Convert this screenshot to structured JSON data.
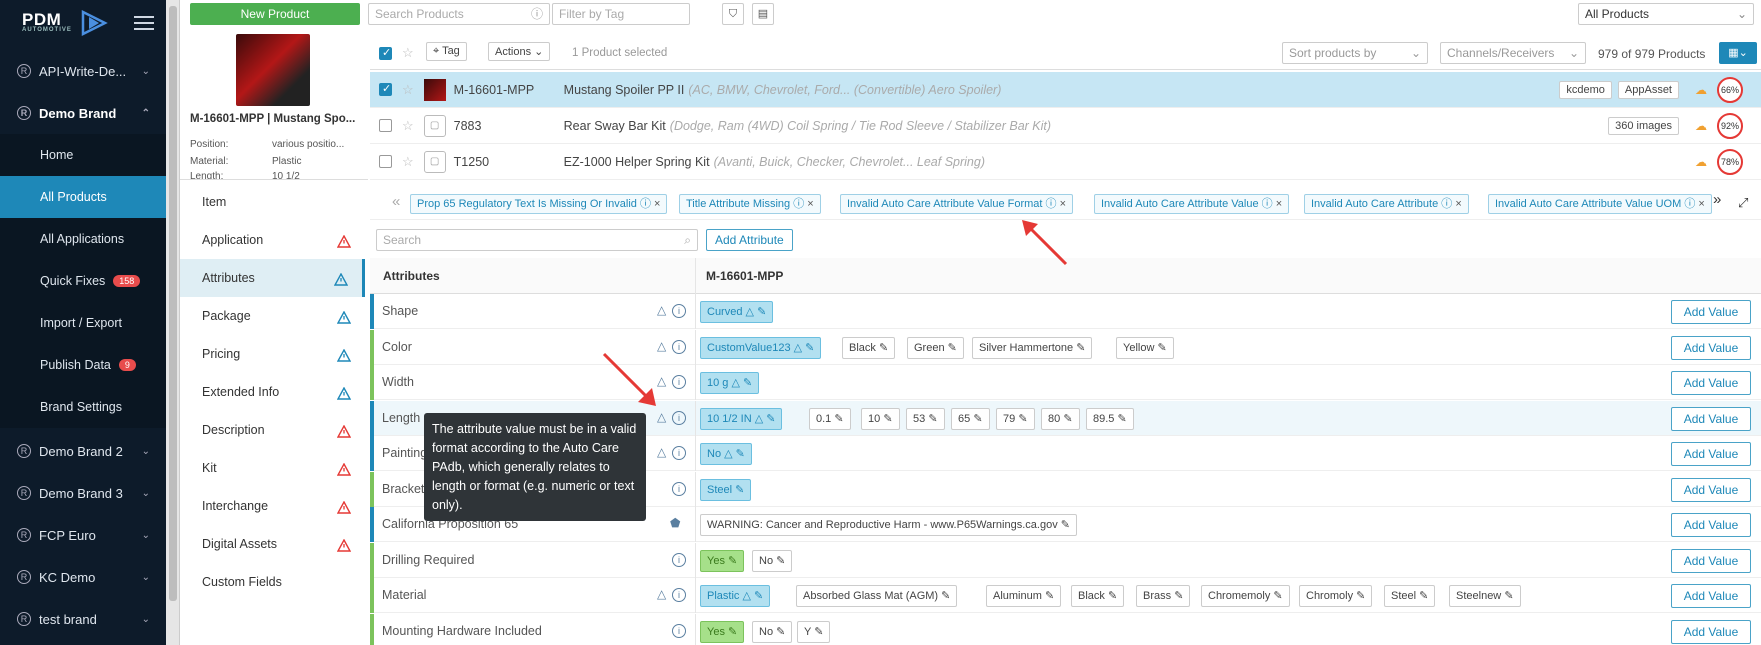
{
  "app": {
    "logo_text": "PDM",
    "logo_sub": "AUTOMOTIVE"
  },
  "sidebar": {
    "brands": [
      {
        "label": "API-Write-De...",
        "expanded": false
      },
      {
        "label": "Demo Brand",
        "expanded": true
      },
      {
        "label": "Demo Brand 2",
        "expanded": false
      },
      {
        "label": "Demo Brand 3",
        "expanded": false
      },
      {
        "label": "FCP Euro",
        "expanded": false
      },
      {
        "label": "KC Demo",
        "expanded": false
      },
      {
        "label": "test brand",
        "expanded": false
      }
    ],
    "sub_items": [
      {
        "label": "Home"
      },
      {
        "label": "All Products",
        "active": true
      },
      {
        "label": "All Applications"
      },
      {
        "label": "Quick Fixes",
        "badge": "158"
      },
      {
        "label": "Import / Export"
      },
      {
        "label": "Publish Data",
        "badge": "9"
      },
      {
        "label": "Brand Settings"
      }
    ]
  },
  "toolbar": {
    "new_product": "New Product",
    "search_placeholder": "Search Products",
    "filter_placeholder": "Filter by Tag",
    "scope_select": "All Products"
  },
  "list_header": {
    "tag": "Tag",
    "actions": "Actions",
    "selected": "1 Product selected",
    "sort": "Sort products by",
    "channels": "Channels/Receivers",
    "count": "979 of 979 Products"
  },
  "products": [
    {
      "part": "M-16601-MPP",
      "name": "Mustang Spoiler PP II",
      "detail": "(AC, BMW, Chevrolet, Ford... (Convertible) Aero Spoiler)",
      "tags": [
        "kcdemo",
        "AppAsset"
      ],
      "score": "66%",
      "selected": true
    },
    {
      "part": "7883",
      "name": "Rear Sway Bar Kit",
      "detail": "(Dodge, Ram (4WD) Coil Spring / Tie Rod Sleeve / Stabilizer Bar Kit)",
      "tags": [
        "360 images"
      ],
      "score": "92%",
      "selected": false
    },
    {
      "part": "T1250",
      "name": "EZ-1000 Helper Spring Kit",
      "detail": "(Avanti, Buick, Checker, Chevrolet... Leaf Spring)",
      "tags": [],
      "score": "78%",
      "selected": false
    }
  ],
  "product_card": {
    "title": "M-16601-MPP | Mustang Spo...",
    "position_label": "Position:",
    "position_value": "various positio...",
    "material_label": "Material:",
    "material_value": "Plastic",
    "length_label": "Length:",
    "length_value": "10 1/2"
  },
  "left_nav": [
    {
      "label": "Item",
      "warn": null
    },
    {
      "label": "Application",
      "warn": "red"
    },
    {
      "label": "Attributes",
      "warn": "blue",
      "active": true
    },
    {
      "label": "Package",
      "warn": "blue"
    },
    {
      "label": "Pricing",
      "warn": "blue"
    },
    {
      "label": "Extended Info",
      "warn": "blue"
    },
    {
      "label": "Description",
      "warn": "red"
    },
    {
      "label": "Kit",
      "warn": "red"
    },
    {
      "label": "Interchange",
      "warn": "red"
    },
    {
      "label": "Digital Assets",
      "warn": "red"
    },
    {
      "label": "Custom Fields",
      "warn": null
    }
  ],
  "filter_chips": [
    "Prop 65 Regulatory Text Is Missing Or Invalid",
    "Title Attribute Missing",
    "Invalid Auto Care Attribute Value Format",
    "Invalid Auto Care Attribute Value",
    "Invalid Auto Care Attribute",
    "Invalid Auto Care Attribute Value UOM"
  ],
  "attr_search_placeholder": "Search",
  "add_attribute": "Add Attribute",
  "table": {
    "col1": "Attributes",
    "col2": "M-16601-MPP",
    "add_value": "Add Value"
  },
  "attributes": [
    {
      "name": "Shape",
      "bar": "#1e88b8",
      "values": [
        {
          "t": "Curved",
          "s": "hl",
          "w": true
        }
      ]
    },
    {
      "name": "Color",
      "bar": "#7cc35c",
      "values": [
        {
          "t": "CustomValue123",
          "s": "hl",
          "w": true
        },
        {
          "t": "Black"
        },
        {
          "t": "Green"
        },
        {
          "t": "Silver Hammertone"
        },
        {
          "t": "Yellow"
        }
      ]
    },
    {
      "name": "Width",
      "bar": "#7cc35c",
      "values": [
        {
          "t": "10 g",
          "s": "hl",
          "w": true
        }
      ]
    },
    {
      "name": "Length",
      "bar": "#1e88b8",
      "values": [
        {
          "t": "10 1/2 IN",
          "s": "hl",
          "w": true
        },
        {
          "t": "0.1"
        },
        {
          "t": "10"
        },
        {
          "t": "53"
        },
        {
          "t": "65"
        },
        {
          "t": "79"
        },
        {
          "t": "80"
        },
        {
          "t": "89.5"
        }
      ]
    },
    {
      "name": "Painting",
      "bar": "#1e88b8",
      "values": [
        {
          "t": "No",
          "s": "hl",
          "w": true
        }
      ]
    },
    {
      "name": "Bracket",
      "bar": "#7cc35c",
      "values": [
        {
          "t": "Steel",
          "s": "hl"
        }
      ]
    },
    {
      "name": "California Proposition 65",
      "bar": "#1e88b8",
      "values": [
        {
          "t": "WARNING: Cancer and Reproductive Harm - www.P65Warnings.ca.gov"
        }
      ]
    },
    {
      "name": "Drilling Required",
      "bar": "#7cc35c",
      "values": [
        {
          "t": "Yes",
          "s": "green"
        },
        {
          "t": "No"
        }
      ]
    },
    {
      "name": "Material",
      "bar": "#7cc35c",
      "values": [
        {
          "t": "Plastic",
          "s": "hl",
          "w": true
        },
        {
          "t": "Absorbed Glass Mat (AGM)"
        },
        {
          "t": "Aluminum"
        },
        {
          "t": "Black"
        },
        {
          "t": "Brass"
        },
        {
          "t": "Chromemoly"
        },
        {
          "t": "Chromoly"
        },
        {
          "t": "Steel"
        },
        {
          "t": "Steelnew"
        }
      ]
    },
    {
      "name": "Mounting Hardware Included",
      "bar": "#7cc35c",
      "values": [
        {
          "t": "Yes",
          "s": "green"
        },
        {
          "t": "No"
        },
        {
          "t": "Y"
        }
      ]
    }
  ],
  "tooltip": "The attribute value must be in a valid format according to the Auto Care PAdb, which generally relates to length or format (e.g. numeric or text only).",
  "colors": {
    "sidebar": "#0d1b2a",
    "accent": "#1e88b8",
    "green": "#4caf50",
    "warn_red": "#e53935"
  }
}
